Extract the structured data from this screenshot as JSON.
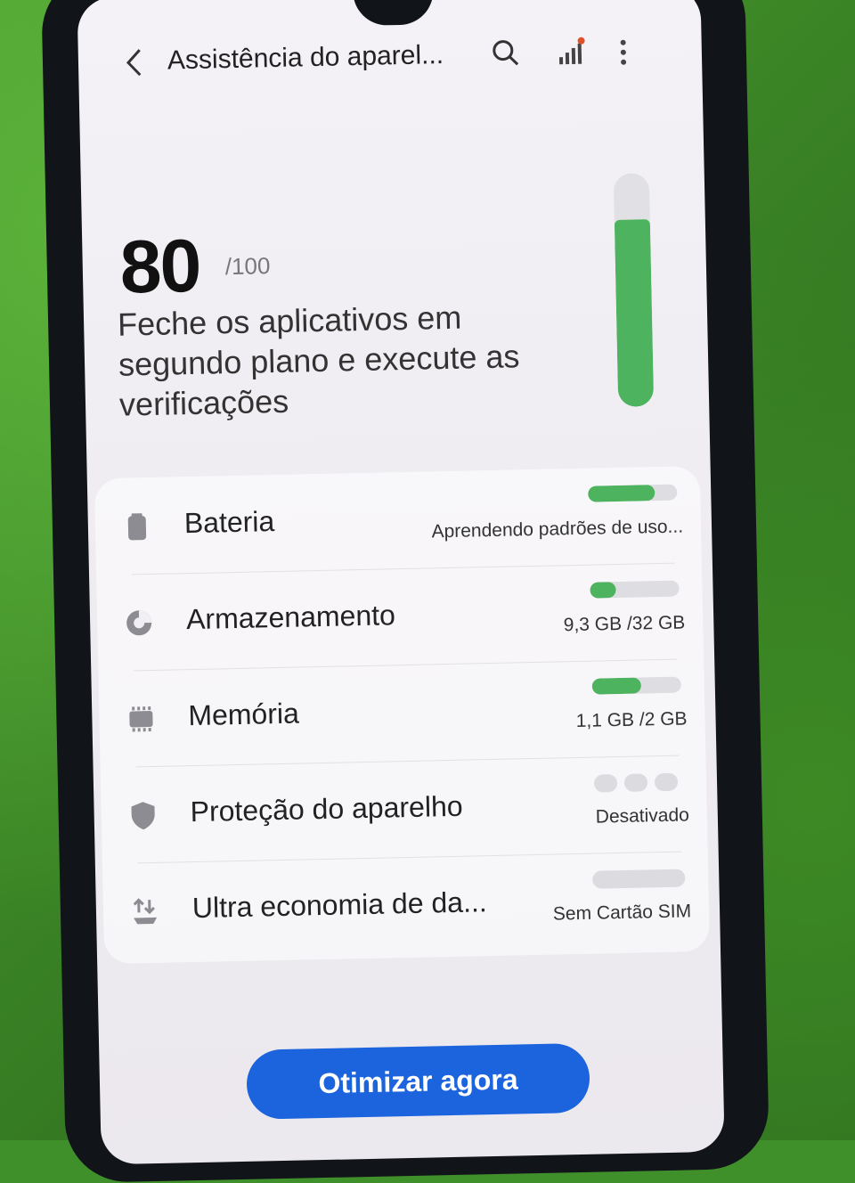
{
  "header": {
    "title": "Assistência do aparel...",
    "back_icon": "back-arrow-icon",
    "search_icon": "search-icon",
    "signal_icon": "signal-bars-icon",
    "more_icon": "more-vertical-icon"
  },
  "score": {
    "value": "80",
    "max": "/100",
    "level_fraction": 0.8,
    "message": "Feche os aplicativos em segundo plano e execute as verificações"
  },
  "items": [
    {
      "label": "Bateria",
      "status": "Aprendendo padrões de uso...",
      "icon": "battery-icon",
      "fill_fraction": 0.75
    },
    {
      "label": "Armazenamento",
      "status": "9,3 GB /32 GB",
      "icon": "storage-icon",
      "fill_fraction": 0.29
    },
    {
      "label": "Memória",
      "status": "1,1 GB /2 GB",
      "icon": "memory-chip-icon",
      "fill_fraction": 0.55
    },
    {
      "label": "Proteção do aparelho",
      "status": "Desativado",
      "icon": "shield-icon"
    },
    {
      "label": "Ultra economia de da...",
      "status": "Sem Cartão SIM",
      "icon": "data-saver-icon"
    }
  ],
  "colors": {
    "accent_green": "#4db35e",
    "button_blue": "#1c63de"
  },
  "action": {
    "label": "Otimizar agora"
  }
}
